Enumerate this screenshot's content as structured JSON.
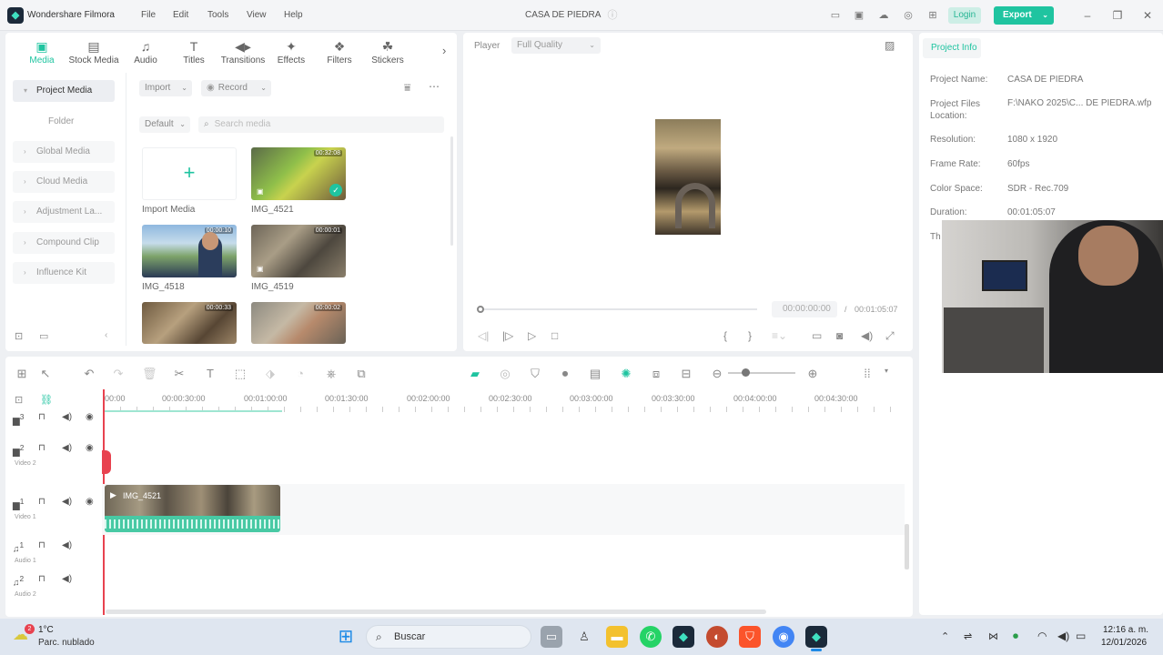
{
  "app": {
    "name": "Wondershare Filmora",
    "menu": [
      "File",
      "Edit",
      "Tools",
      "View",
      "Help"
    ],
    "project_title": "CASA DE PIEDRA",
    "login_label": "Login",
    "export_label": "Export"
  },
  "media_toolbar": [
    {
      "label": "Media",
      "icon": "media-icon",
      "active": true
    },
    {
      "label": "Stock Media",
      "icon": "stock-media-icon"
    },
    {
      "label": "Audio",
      "icon": "music-note-icon"
    },
    {
      "label": "Titles",
      "icon": "text-icon"
    },
    {
      "label": "Transitions",
      "icon": "transitions-icon"
    },
    {
      "label": "Effects",
      "icon": "effects-icon"
    },
    {
      "label": "Filters",
      "icon": "filters-icon"
    },
    {
      "label": "Stickers",
      "icon": "stickers-icon"
    }
  ],
  "sidebar": {
    "items": [
      "Project Media",
      "Folder",
      "Global Media",
      "Cloud Media",
      "Adjustment La...",
      "Compound Clip",
      "Influence Kit"
    ]
  },
  "media_panel": {
    "import_label": "Import",
    "record_label": "Record",
    "sort_label": "Default",
    "search_placeholder": "Search media",
    "import_media_label": "Import Media",
    "items": [
      {
        "name": "IMG_4521",
        "duration": "00:32:08"
      },
      {
        "name": "IMG_4518",
        "duration": "00:00:10"
      },
      {
        "name": "IMG_4519",
        "duration": "00:00:01"
      },
      {
        "name": "",
        "duration": "00:00:33"
      },
      {
        "name": "",
        "duration": "00:00:02"
      }
    ]
  },
  "player": {
    "label": "Player",
    "quality": "Full Quality",
    "current_time": "00:00:00:00",
    "total_time": "00:01:05:07",
    "separator": "/",
    "progress": 0
  },
  "project_info": {
    "tab_label": "Project Info",
    "rows": [
      {
        "key": "Project Name:",
        "value": "CASA DE PIEDRA"
      },
      {
        "key": "Project Files Location:",
        "value": "F:\\NAKO 2025\\C... DE PIEDRA.wfp"
      },
      {
        "key": "Resolution:",
        "value": "1080 x 1920"
      },
      {
        "key": "Frame Rate:",
        "value": "60fps"
      },
      {
        "key": "Color Space:",
        "value": "SDR - Rec.709"
      },
      {
        "key": "Duration:",
        "value": "00:01:05:07"
      }
    ],
    "truncated_label": "Th"
  },
  "timeline": {
    "ruler": [
      "00:00",
      "00:00:30:00",
      "00:01:00:00",
      "00:01:30:00",
      "00:02:00:00",
      "00:02:30:00",
      "00:03:00:00",
      "00:03:30:00",
      "00:04:00:00",
      "00:04:30:00"
    ],
    "tracks": [
      {
        "num": "3",
        "name": ""
      },
      {
        "num": "2",
        "name": "Video 2"
      },
      {
        "num": "1",
        "name": "Video 1"
      },
      {
        "num": "1",
        "name": "Audio 1"
      },
      {
        "num": "2",
        "name": "Audio 2"
      }
    ],
    "clip_label": "IMG_4521"
  },
  "taskbar": {
    "temperature": "1°C",
    "weather": "Parc. nublado",
    "weather_badge": "2",
    "search_label": "Buscar",
    "time": "12:16 a. m.",
    "date": "12/01/2026"
  },
  "colors": {
    "accent": "#1fc4a0",
    "playhead": "#e8424f"
  }
}
